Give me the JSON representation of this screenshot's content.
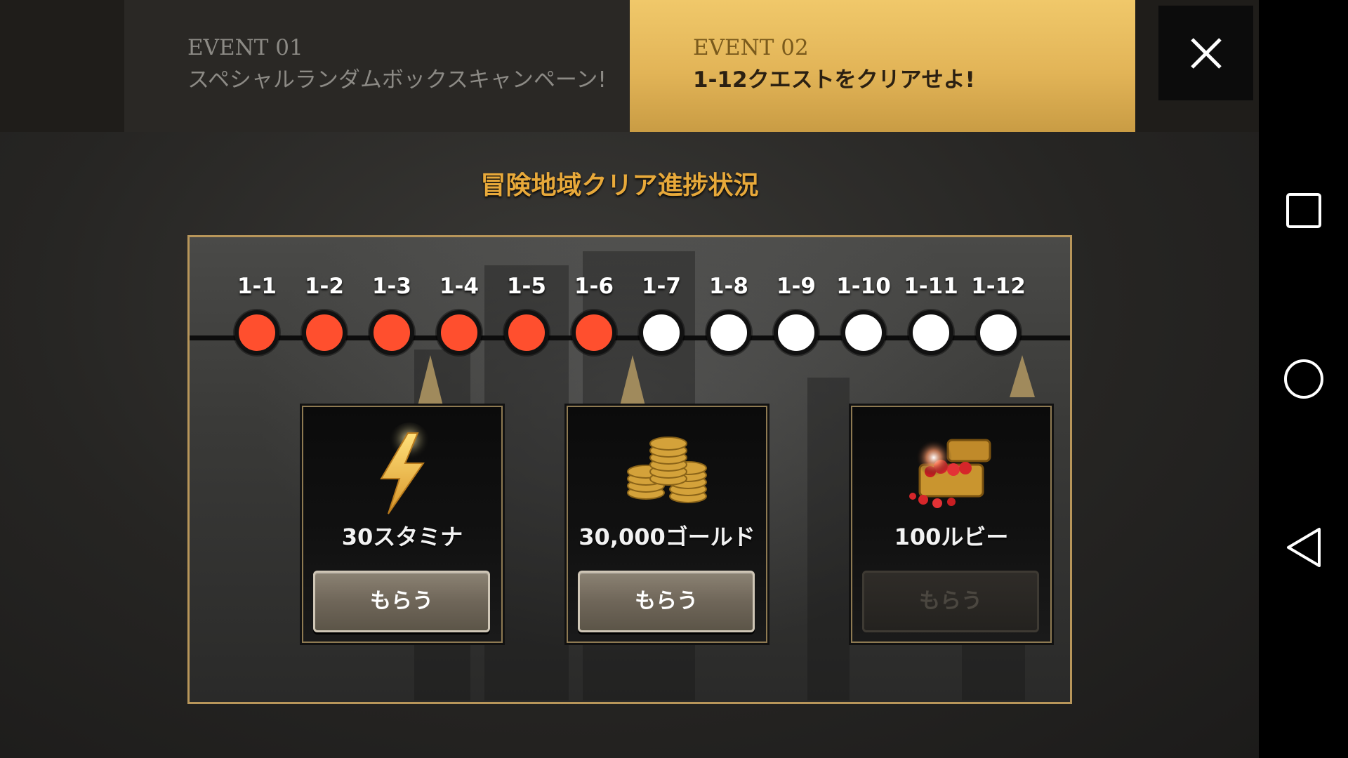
{
  "tabs": [
    {
      "number": "EVENT 01",
      "title": "スペシャルランダムボックスキャンペーン!",
      "active": false
    },
    {
      "number": "EVENT 02",
      "title": "1-12クエストをクリアせよ!",
      "active": true
    }
  ],
  "section_title": "冒険地域クリア進捗状況",
  "stages": [
    {
      "label": "1-1",
      "cleared": true
    },
    {
      "label": "1-2",
      "cleared": true
    },
    {
      "label": "1-3",
      "cleared": true
    },
    {
      "label": "1-4",
      "cleared": true
    },
    {
      "label": "1-5",
      "cleared": true
    },
    {
      "label": "1-6",
      "cleared": true
    },
    {
      "label": "1-7",
      "cleared": false
    },
    {
      "label": "1-8",
      "cleared": false
    },
    {
      "label": "1-9",
      "cleared": false
    },
    {
      "label": "1-10",
      "cleared": false
    },
    {
      "label": "1-11",
      "cleared": false
    },
    {
      "label": "1-12",
      "cleared": false
    }
  ],
  "rewards": [
    {
      "label": "30スタミナ",
      "icon": "lightning-icon",
      "button": "もらう",
      "claimable": true
    },
    {
      "label": "30,000ゴールド",
      "icon": "gold-coins-icon",
      "button": "もらう",
      "claimable": true
    },
    {
      "label": "100ルビー",
      "icon": "treasure-chest-icon",
      "button": "もらう",
      "claimable": false
    }
  ],
  "colors": {
    "cleared": "#ff4f2e",
    "uncleared": "#ffffff",
    "accent": "#e8a93a"
  },
  "navbar": {
    "recent": "square-icon",
    "home": "circle-icon",
    "back": "triangle-back-icon"
  }
}
